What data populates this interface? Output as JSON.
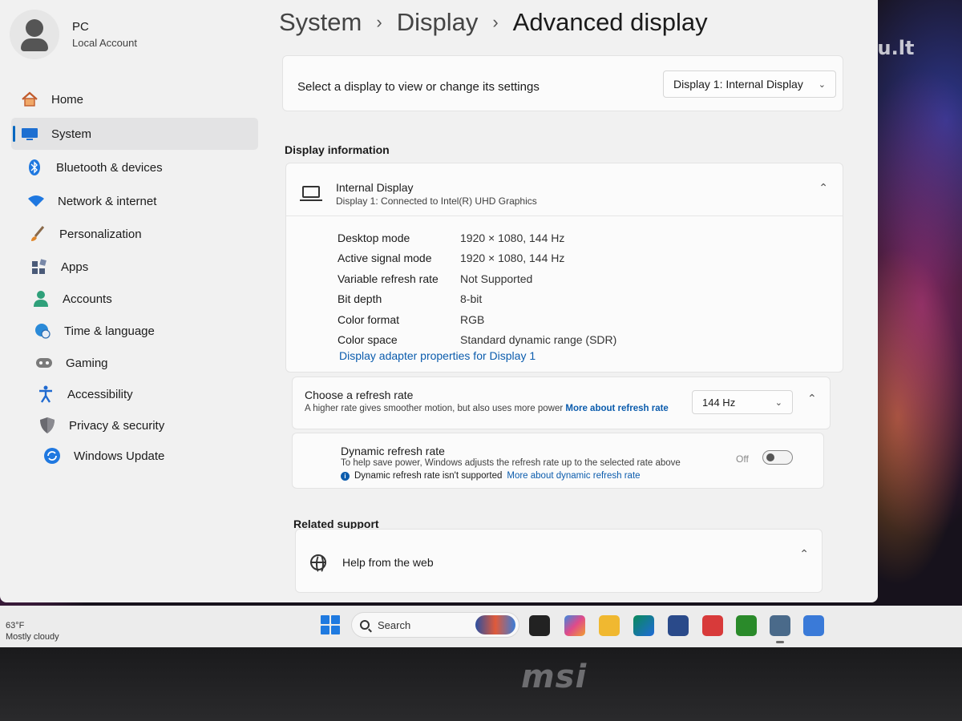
{
  "watermark": "skelbiu.lt",
  "brand": "msi",
  "profile": {
    "name": "PC",
    "account_type": "Local Account"
  },
  "nav": {
    "items": [
      {
        "label": "Home",
        "icon": "home-icon"
      },
      {
        "label": "System",
        "icon": "monitor-icon",
        "active": true
      },
      {
        "label": "Bluetooth & devices",
        "icon": "bluetooth-icon"
      },
      {
        "label": "Network & internet",
        "icon": "wifi-icon"
      },
      {
        "label": "Personalization",
        "icon": "brush-icon"
      },
      {
        "label": "Apps",
        "icon": "apps-icon"
      },
      {
        "label": "Accounts",
        "icon": "person-icon"
      },
      {
        "label": "Time & language",
        "icon": "globe-clock-icon"
      },
      {
        "label": "Gaming",
        "icon": "gamepad-icon"
      },
      {
        "label": "Accessibility",
        "icon": "accessibility-icon"
      },
      {
        "label": "Privacy & security",
        "icon": "shield-icon"
      },
      {
        "label": "Windows Update",
        "icon": "update-icon"
      }
    ]
  },
  "breadcrumb": {
    "level1": "System",
    "level2": "Display",
    "current": "Advanced display",
    "separator": "›"
  },
  "display_select": {
    "label": "Select a display to view or change its settings",
    "value": "Display 1: Internal Display"
  },
  "display_info": {
    "section_title": "Display information",
    "title": "Internal Display",
    "subtitle": "Display 1: Connected to Intel(R) UHD Graphics",
    "rows": [
      {
        "key": "Desktop mode",
        "value": "1920 × 1080, 144 Hz"
      },
      {
        "key": "Active signal mode",
        "value": "1920 × 1080, 144 Hz"
      },
      {
        "key": "Variable refresh rate",
        "value": "Not Supported"
      },
      {
        "key": "Bit depth",
        "value": "8-bit"
      },
      {
        "key": "Color format",
        "value": "RGB"
      },
      {
        "key": "Color space",
        "value": "Standard dynamic range (SDR)"
      }
    ],
    "adapter_link": "Display adapter properties for Display 1"
  },
  "refresh": {
    "title": "Choose a refresh rate",
    "description": "A higher rate gives smoother motion, but also uses more power",
    "link": "More about refresh rate",
    "value": "144 Hz"
  },
  "dynamic_refresh": {
    "title": "Dynamic refresh rate",
    "description": "To help save power, Windows adjusts the refresh rate up to the selected rate above",
    "note": "Dynamic refresh rate isn't supported",
    "link": "More about dynamic refresh rate",
    "toggle_state": "Off"
  },
  "related": {
    "section_title": "Related support",
    "help_label": "Help from the web"
  },
  "taskbar": {
    "weather_temp": "63°F",
    "weather_desc": "Mostly cloudy",
    "search_label": "Search"
  },
  "colors": {
    "accent": "#0067c0",
    "link": "#0b5cad",
    "window_bg": "#f1f1f1",
    "card_bg": "#fbfbfb"
  }
}
